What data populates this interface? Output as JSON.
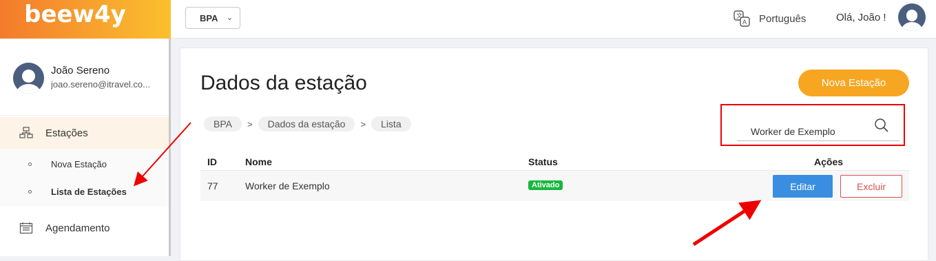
{
  "app": {
    "logo": "beew4y"
  },
  "topbar": {
    "org_select": "BPA",
    "language": "Português",
    "greeting": "Olá, João !"
  },
  "sidebar": {
    "profile": {
      "name": "João Sereno",
      "email": "joao.sereno@itravel.co..."
    },
    "items": [
      {
        "label": "Estações",
        "icon": "stations-icon",
        "active": true,
        "children": [
          {
            "label": "Nova Estação",
            "active": false
          },
          {
            "label": "Lista de Estações",
            "active": true
          }
        ]
      },
      {
        "label": "Agendamento",
        "icon": "calendar-icon"
      }
    ]
  },
  "main": {
    "title": "Dados da estação",
    "new_button": "Nova Estação",
    "breadcrumb": [
      "BPA",
      "Dados da estação",
      "Lista"
    ],
    "search": {
      "value": "Worker de Exemplo"
    },
    "table": {
      "columns": [
        "ID",
        "Nome",
        "Status",
        "Ações"
      ],
      "rows": [
        {
          "id": "77",
          "name": "Worker de Exemplo",
          "status": "Ativado",
          "edit": "Editar",
          "delete": "Excluir"
        }
      ]
    }
  },
  "colors": {
    "accent": "#f7a621",
    "status_active": "#17b83d",
    "edit_button": "#3a8ee0",
    "delete_button": "#d65050",
    "annotation": "#e00000"
  }
}
